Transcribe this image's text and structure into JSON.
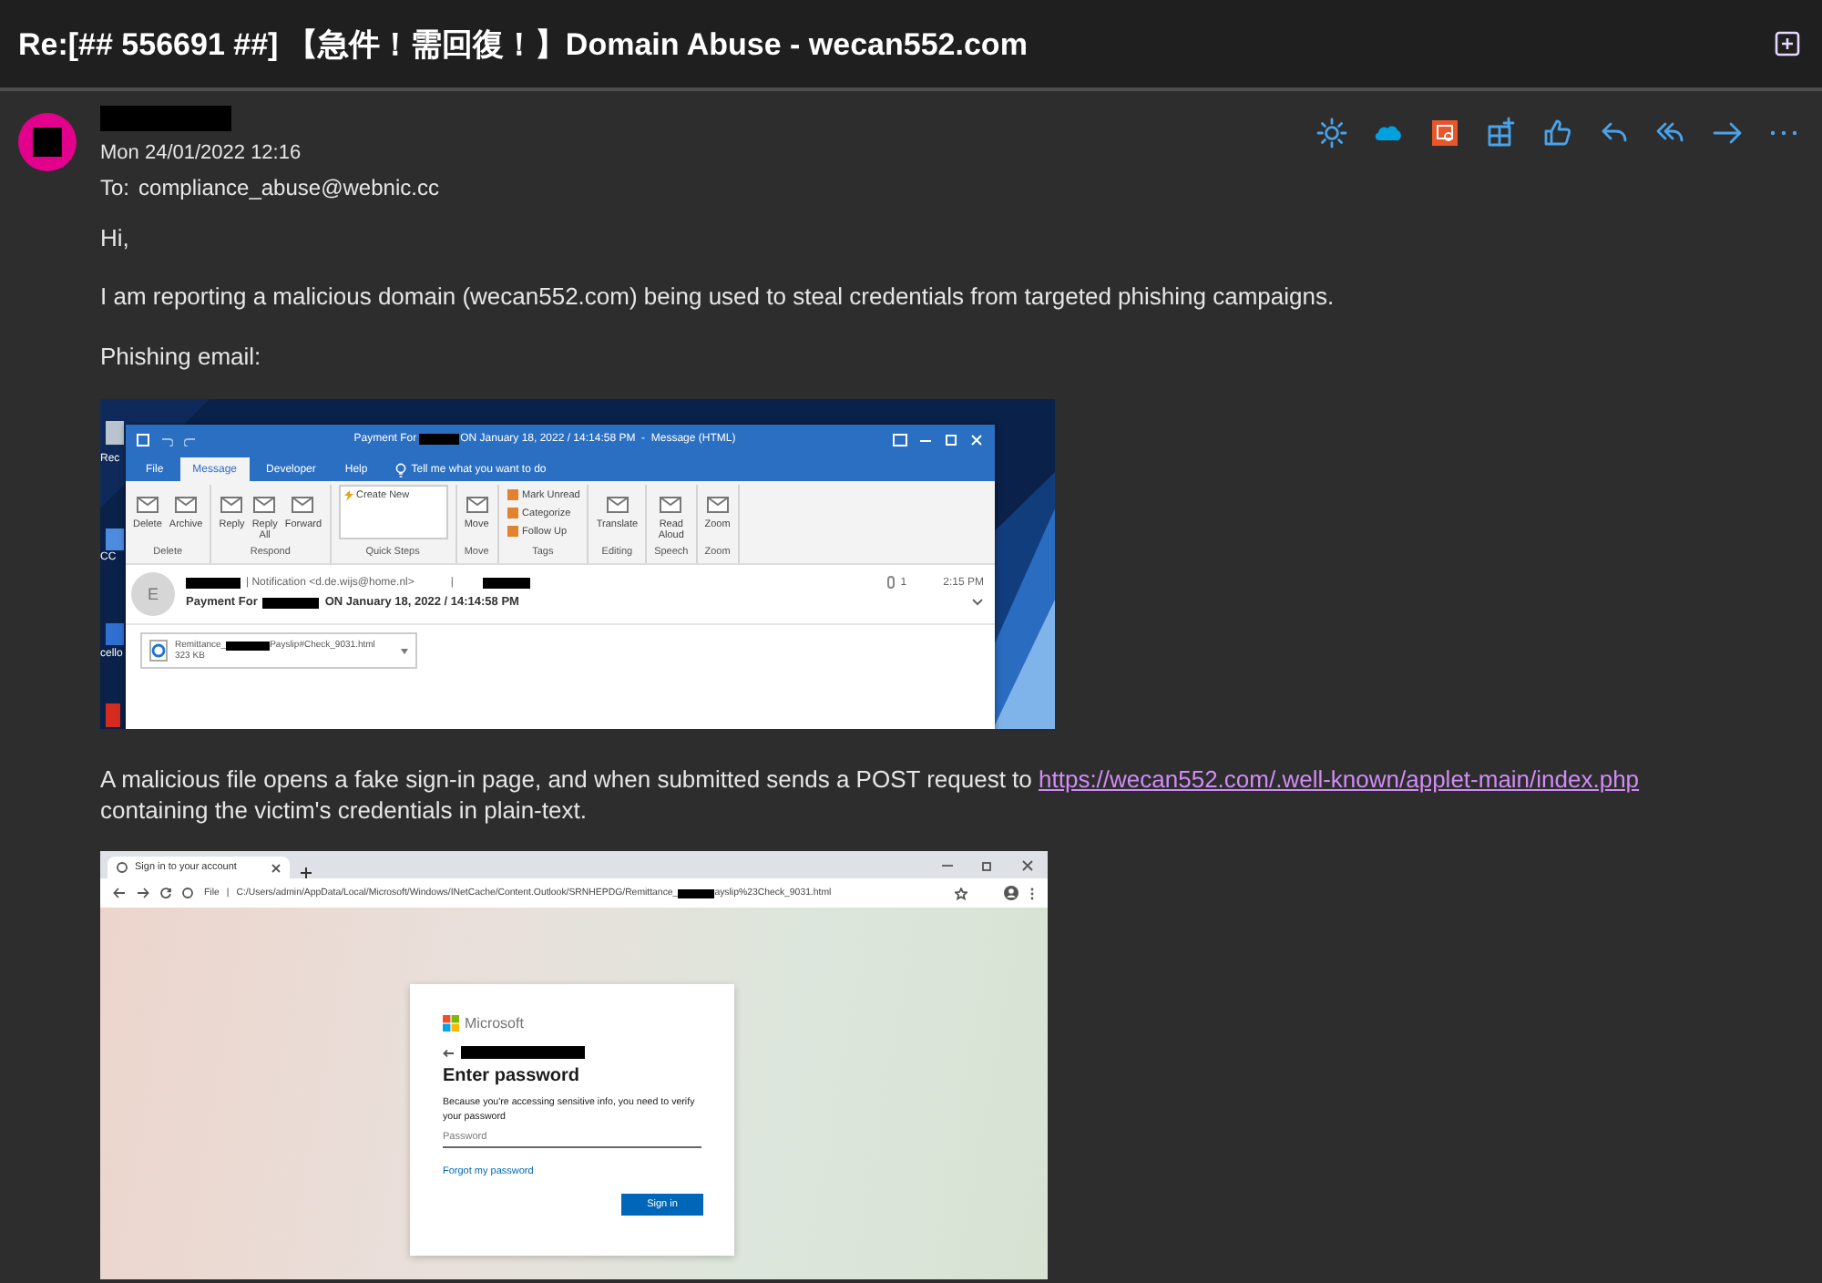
{
  "window": {
    "title": "Re:[## 556691 ##] 【急件！需回復！】Domain Abuse - wecan552.com"
  },
  "message": {
    "date": "Mon 24/01/2022 12:16",
    "to_label": "To:",
    "to": "compliance_abuse@webnic.cc"
  },
  "body": {
    "greeting": "Hi,",
    "paragraph_1": "I am reporting a malicious domain (wecan552.com) being used to steal credentials from targeted phishing campaigns.",
    "phishing_label": "Phishing email:",
    "paragraph_2_before": "A malicious file opens a fake sign-in page, and when submitted sends a POST request to",
    "link": "https://wecan552.com/.well-known/applet-main/index.php",
    "paragraph_2_after": "containing the victim's credentials in plain-text."
  },
  "phishing_screenshot": {
    "desktop_labels": [
      "Rec",
      "CC",
      "cello"
    ],
    "title_before": "Payment For",
    "title_after": "ON January 18, 2022 / 14:14:58 PM  -  Message (HTML)",
    "tabs": [
      {
        "label": "File",
        "selected": false
      },
      {
        "label": "Message",
        "selected": true
      },
      {
        "label": "Developer",
        "selected": false
      },
      {
        "label": "Help",
        "selected": false
      }
    ],
    "tell_me": "Tell me what you want to do",
    "ribbon_groups": [
      {
        "label": "Delete",
        "kind": "large",
        "buttons": [
          "Delete",
          "Archive"
        ]
      },
      {
        "label": "Respond",
        "kind": "large",
        "buttons": [
          "Reply",
          "Reply All",
          "Forward"
        ]
      },
      {
        "label": "Quick Steps",
        "kind": "gallery",
        "buttons": [
          "Create New"
        ]
      },
      {
        "label": "Move",
        "kind": "large",
        "buttons": [
          "Move"
        ]
      },
      {
        "label": "Tags",
        "kind": "small",
        "buttons": [
          "Mark Unread",
          "Categorize",
          "Follow Up"
        ]
      },
      {
        "label": "Editing",
        "kind": "large",
        "buttons": [
          "Translate"
        ]
      },
      {
        "label": "Speech",
        "kind": "large",
        "buttons": [
          "Read Aloud"
        ]
      },
      {
        "label": "Zoom",
        "kind": "large",
        "buttons": [
          "Zoom"
        ]
      }
    ],
    "sender_initial": "E",
    "sender": "| Notification <d.de.wijs@home.nl>",
    "separator": "|",
    "attachment_count": "1",
    "time": "2:15 PM",
    "subject_before": "Payment For",
    "subject_after": "ON January 18, 2022 / 14:14:58 PM",
    "attachment_before": "Remittance_",
    "attachment_after": "Payslip#Check_9031.html",
    "attachment_size": "323 KB"
  },
  "sign_in_screenshot": {
    "tab_title": "Sign in to your account",
    "scheme": "File",
    "separator": "|",
    "url_before": "C:/Users/admin/AppData/Local/Microsoft/Windows/INetCache/Content.Outlook/SRNHEPDG/Remittance_",
    "url_after": "ayslip%23Check_9031.html",
    "brand": "Microsoft",
    "heading": "Enter password",
    "description": "Because you're accessing sensitive info, you need to verify your password",
    "placeholder": "Password",
    "forgot_link": "Forgot my password",
    "button": "Sign in"
  }
}
